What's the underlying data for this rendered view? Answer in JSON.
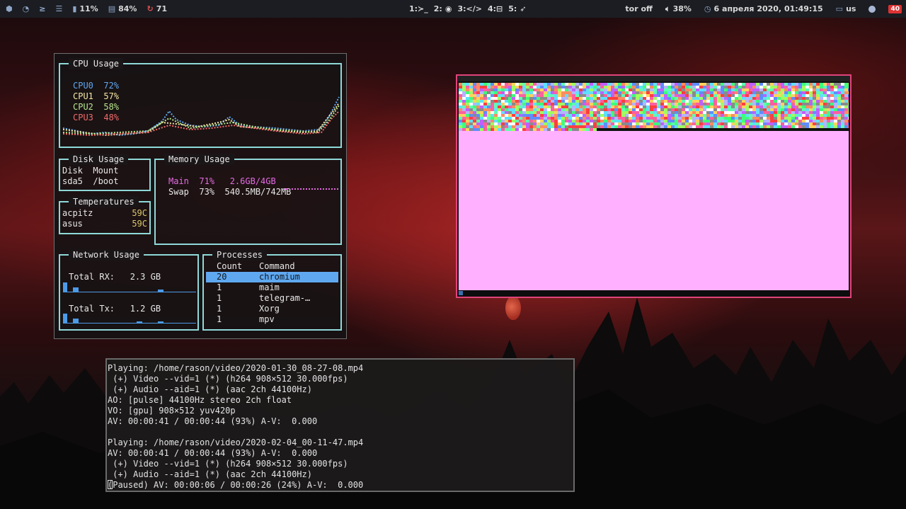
{
  "topbar": {
    "left": [
      {
        "icon": "hexagon-icon",
        "text": ""
      },
      {
        "icon": "update-icon",
        "text": ""
      },
      {
        "icon": "terminal-prompt-icon",
        "text": ""
      },
      {
        "icon": "rss-icon",
        "text": ""
      },
      {
        "icon": "battery-icon",
        "text": "11%"
      },
      {
        "icon": "memory-icon",
        "text": "84%"
      },
      {
        "icon": "sync-icon",
        "text": "71"
      }
    ],
    "workspaces": [
      "1:≻_",
      "2:",
      "3:</>",
      "4:⊟",
      "5:"
    ],
    "right": {
      "tor": "tor off",
      "volume": "38%",
      "datetime": "6 апреля 2020, 01:49:15",
      "keyboard": "us",
      "badge": "40"
    }
  },
  "gotop": {
    "cpu": {
      "title": "CPU Usage",
      "cores": [
        {
          "label": "CPU0",
          "value": "72%"
        },
        {
          "label": "CPU1",
          "value": "57%"
        },
        {
          "label": "CPU2",
          "value": "58%"
        },
        {
          "label": "CPU3",
          "value": "48%"
        }
      ]
    },
    "disk": {
      "title": "Disk Usage",
      "header": "Disk  Mount",
      "row": "sda5  /boot"
    },
    "memory": {
      "title": "Memory Usage",
      "main": "Main  71%   2.6GB/4GB",
      "swap": "Swap  73%  540.5MB/742MB"
    },
    "temps": {
      "title": "Temperatures",
      "rows": [
        {
          "name": "acpitz",
          "value": "59C"
        },
        {
          "name": "asus",
          "value": "59C"
        }
      ]
    },
    "network": {
      "title": "Network Usage",
      "rx": "Total RX:   2.3 GB",
      "tx": "Total Tx:   1.2 GB"
    },
    "processes": {
      "title": "Processes",
      "headers": [
        "Count",
        "Command"
      ],
      "rows": [
        {
          "count": "20",
          "command": "chromium"
        },
        {
          "count": "1",
          "command": "maim"
        },
        {
          "count": "1",
          "command": "telegram-…"
        },
        {
          "count": "1",
          "command": "Xorg"
        },
        {
          "count": "1",
          "command": "mpv"
        }
      ]
    }
  },
  "terminal": {
    "lines": [
      "Playing: /home/rason/video/2020-01-30_08-27-08.mp4",
      " (+) Video --vid=1 (*) (h264 908×512 30.000fps)",
      " (+) Audio --aid=1 (*) (aac 2ch 44100Hz)",
      "AO: [pulse] 44100Hz stereo 2ch float",
      "VO: [gpu] 908×512 yuv420p",
      "AV: 00:00:41 / 00:00:44 (93%) A-V:  0.000",
      "",
      "Playing: /home/rason/video/2020-02-04_00-11-47.mp4",
      "AV: 00:00:41 / 00:00:44 (93%) A-V:  0.000",
      " (+) Video --vid=1 (*) (h264 908×512 30.000fps)",
      " (+) Audio --aid=1 (*) (aac 2ch 44100Hz)"
    ],
    "last_line": "(Paused) AV: 00:00:06 / 00:00:26 (24%) A-V:  0.000"
  },
  "colors": {
    "accent_cyan": "#8fd9d9",
    "cpu_blue": "#5fa8f0",
    "browser_border": "#e0437a",
    "page_pink": "#ffb1ff"
  }
}
